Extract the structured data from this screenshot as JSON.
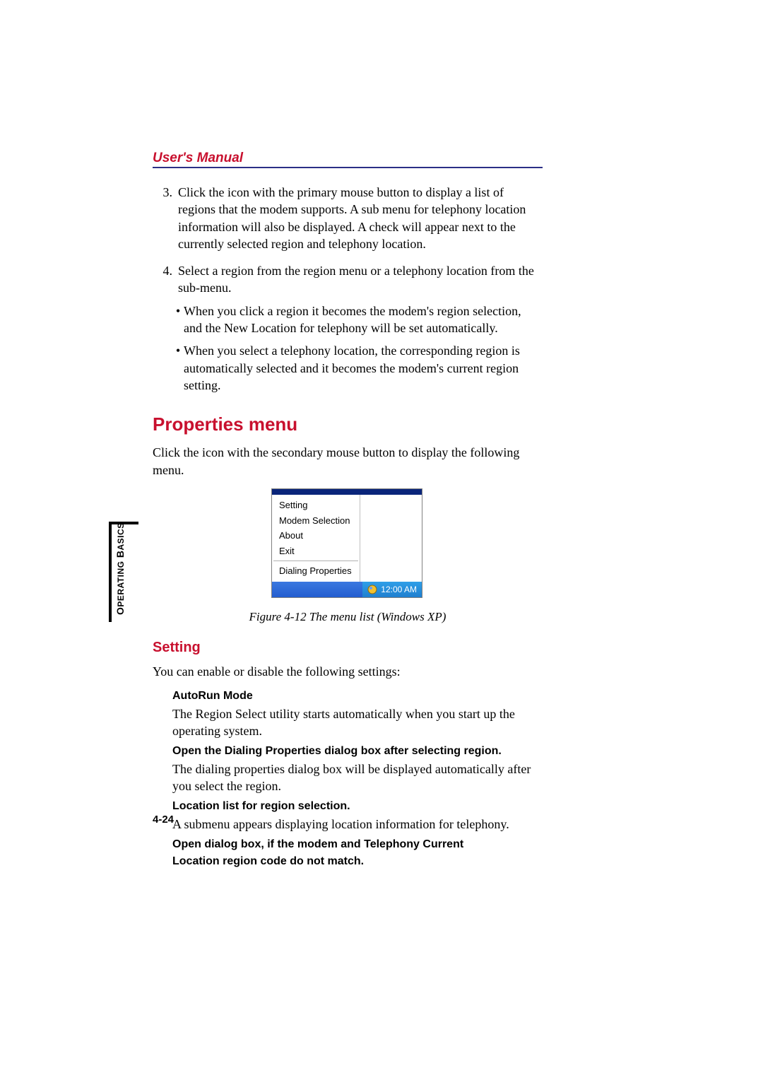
{
  "header": {
    "title": "User's Manual"
  },
  "steps": {
    "s3_num": "3.",
    "s3": "Click the icon with the primary mouse button to display a list of regions that the modem supports. A sub menu for telephony location information will also be displayed. A check will appear next to the currently selected region and telephony location.",
    "s4_num": "4.",
    "s4": "Select a region from the region menu or a telephony location from the sub-menu.",
    "b1": "When you click a region it becomes the modem's region selection, and the New Location for telephony will be set automatically.",
    "b2": "When you select a telephony location, the corresponding region is automatically selected and it becomes the modem's current region setting."
  },
  "h2": "Properties menu",
  "p_h2": "Click the icon with the secondary mouse button to display the following menu.",
  "menu": {
    "items": [
      "Setting",
      "Modem Selection",
      "About",
      "Exit"
    ],
    "sep_item": "Dialing Properties",
    "time": "12:00 AM"
  },
  "figure_caption": "Figure 4-12 The menu list (Windows XP)",
  "h3": "Setting",
  "p_h3": "You can enable or disable the following settings:",
  "settings": {
    "t1": "AutoRun Mode",
    "d1": "The Region Select utility starts automatically when you start up the operating system.",
    "t2": "Open the Dialing Properties dialog box after selecting region.",
    "d2": "The dialing properties dialog box will be displayed automatically after you select the region.",
    "t3": "Location list for region selection.",
    "d3": "A submenu appears displaying location information for telephony.",
    "t4a": "Open dialog box, if the modem and Telephony Current",
    "t4b": "Location region code do not match."
  },
  "side_tab": {
    "big1": "O",
    "small1": "PERATING",
    "big2": " B",
    "small2": "ASICS"
  },
  "page_number": "4-24"
}
